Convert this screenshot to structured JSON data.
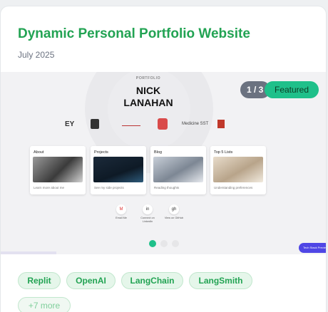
{
  "project": {
    "title": "Dynamic Personal Portfolio Website",
    "date": "July 2025"
  },
  "preview": {
    "counter": "1 / 3",
    "badge": "Featured",
    "kicker": "PORTFOLIO",
    "name_line1": "NICK",
    "name_line2": "LANAHAN",
    "logos": [
      "EY",
      "ARMY",
      "CLEMSON",
      "HD",
      "Medicine SST",
      "SC"
    ],
    "cards": [
      {
        "title": "About",
        "caption": "Learn more about me"
      },
      {
        "title": "Projects",
        "caption": "See my side projects"
      },
      {
        "title": "Blog",
        "caption": "Reading thoughts"
      },
      {
        "title": "Top 5 Lists",
        "caption": "Understanding preferences"
      }
    ],
    "contacts": [
      {
        "icon": "M",
        "label": "Email Me"
      },
      {
        "icon": "in",
        "label": "Connect on LinkedIn"
      },
      {
        "icon": "gh",
        "label": "View on GitHub"
      }
    ],
    "active_slide": 1,
    "slide_count": 3,
    "corner_pill": "Tech Stack Preview"
  },
  "tags": [
    "Replit",
    "OpenAI",
    "LangChain",
    "LangSmith"
  ],
  "more_tag": "+7 more",
  "colors": {
    "title_green": "#22a353",
    "featured_green": "#1fc08a",
    "tag_bg": "#e5f6ea",
    "counter_gray": "#6b7280"
  }
}
